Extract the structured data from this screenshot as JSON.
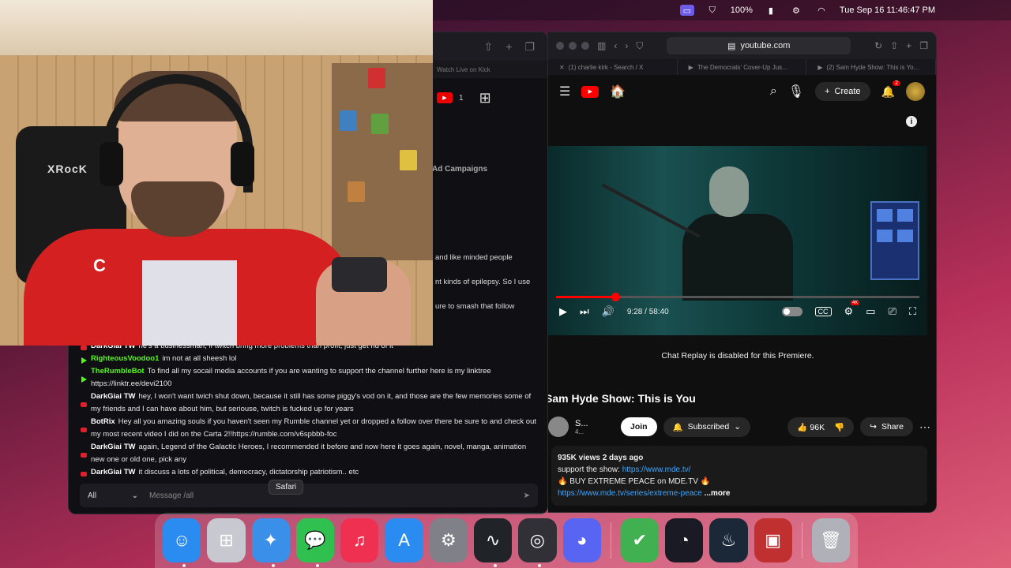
{
  "menubar": {
    "battery": "100%",
    "datetime": "Tue Sep 16  11:46:47 PM"
  },
  "chat": {
    "tab_title": "Watch Live on Kick",
    "youtube_count": "1",
    "ad_campaigns": "Ad Campaigns",
    "snippets": [
      "and like minded people",
      "nt kinds of epilepsy. So I use",
      "ure to smash that follow"
    ],
    "messages": [
      {
        "platform": "yt",
        "user": "DarkGiai TW",
        "text": "he's a businessman, if twitch bring more problems than profit, just get rid of it",
        "color": "white"
      },
      {
        "platform": "kick",
        "user": "RighteousVoodoo1",
        "text": "im not at all sheesh lol",
        "color": "green"
      },
      {
        "platform": "kick",
        "user": "TheRumbleBot",
        "text": "To find all my socail media accounts if you are wanting to support the channel further here is my linktree https://linktr.ee/devi2100",
        "color": "green"
      },
      {
        "platform": "yt",
        "user": "DarkGiai TW",
        "text": "hey, I won't want twich shut down, because it still has some piggy's vod on it, and those are the few memories some of my friends and I can have about him, but seriouse, twitch is fucked up for years",
        "color": "white"
      },
      {
        "platform": "yt",
        "user": "BotRix",
        "text": "Hey all you amazing souls if you haven't seen my Rumble channel yet or dropped a follow over there be sure to and check out my most recent video I did on the Carta 2!!https://rumble.com/v6spbbb-foc",
        "color": "white"
      },
      {
        "platform": "yt",
        "user": "DarkGiai TW",
        "text": "again, Legend of the Galactic Heroes, I recommended it before and now here it goes again, novel, manga, animation new one or old one, pick any",
        "color": "white"
      },
      {
        "platform": "yt",
        "user": "DarkGiai TW",
        "text": "it discuss a lots of political, democracy, dictatorship patriotism.. etc",
        "color": "white"
      }
    ],
    "input_select": "All",
    "input_placeholder": "Message /all"
  },
  "webcam": {
    "chair_text": "XRocK",
    "jersey_logo": "C"
  },
  "browser": {
    "url": "youtube.com",
    "tabs": [
      "(1) charlie kirk - Search / X",
      "The Democrats' Cover-Up Jus...",
      "(2) Sam Hyde Show: This is Yo..."
    ]
  },
  "youtube": {
    "create_label": "Create",
    "notif_count": "2",
    "time_display": "9:28 / 58:40",
    "progress": 0.163,
    "replay_msg": "Chat Replay is disabled for this Premiere.",
    "title": "Sam Hyde Show: This is You",
    "channel_name": "S...",
    "channel_subs": "4...",
    "join_label": "Join",
    "subscribed_label": "Subscribed",
    "likes": "96K",
    "share_label": "Share",
    "views_line": "935K views  2 days ago",
    "support_text": "support the show: ",
    "support_link": "https://www.mde.tv/",
    "buy_line": "🔥 BUY EXTREME PEACE on MDE.TV 🔥",
    "series_link": "https://www.mde.tv/series/extreme-peace",
    "more_label": "...more"
  },
  "dock": {
    "tooltip": "Safari",
    "items": [
      {
        "name": "finder-icon",
        "color": "#2a8cf0"
      },
      {
        "name": "launchpad-icon",
        "color": "#c8c8d0"
      },
      {
        "name": "safari-icon",
        "color": "#3a90e8"
      },
      {
        "name": "messages-icon",
        "color": "#30c050"
      },
      {
        "name": "music-icon",
        "color": "#f03050"
      },
      {
        "name": "app-store-icon",
        "color": "#2a8cf0"
      },
      {
        "name": "system-settings-icon",
        "color": "#808088"
      },
      {
        "name": "activity-monitor-icon",
        "color": "#202428"
      },
      {
        "name": "obs-icon",
        "color": "#303036"
      },
      {
        "name": "discord-icon",
        "color": "#5865f2"
      },
      {
        "name": "adguard-icon",
        "color": "#40b050"
      },
      {
        "name": "speedtest-icon",
        "color": "#1a1a24"
      },
      {
        "name": "steam-icon",
        "color": "#1b2838"
      },
      {
        "name": "photo-booth-icon",
        "color": "#c03030"
      },
      {
        "name": "trash-icon",
        "color": "#b0b0b8"
      }
    ]
  }
}
